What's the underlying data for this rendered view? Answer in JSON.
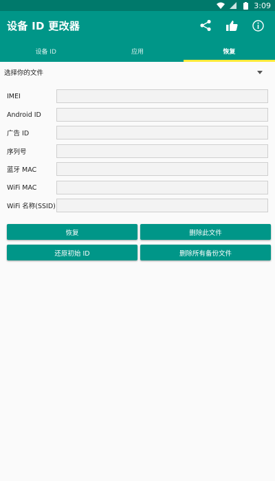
{
  "status_bar": {
    "time": "3:09"
  },
  "app_bar": {
    "title": "设备 ID 更改器"
  },
  "tabs": [
    {
      "label": "设备 ID"
    },
    {
      "label": "应用"
    },
    {
      "label": "恢复"
    }
  ],
  "file_select": {
    "label": "选择你的文件"
  },
  "fields": [
    {
      "label": "IMEI",
      "value": ""
    },
    {
      "label": "Android ID",
      "value": ""
    },
    {
      "label": "广告 ID",
      "value": ""
    },
    {
      "label": "序列号",
      "value": ""
    },
    {
      "label": "蓝牙 MAC",
      "value": ""
    },
    {
      "label": "WiFi MAC",
      "value": ""
    },
    {
      "label": "WiFi 名称(SSID)",
      "value": ""
    }
  ],
  "buttons": {
    "restore": "恢复",
    "delete_file": "删除此文件",
    "restore_original": "还原初始 ID",
    "delete_all": "删除所有备份文件"
  },
  "colors": {
    "primary": "#009688",
    "status_bar": "#00796b",
    "tab_indicator": "#ffeb3b"
  },
  "icons": {
    "status": [
      "wifi-icon",
      "signal-icon",
      "battery-icon"
    ],
    "actions": [
      "share-icon",
      "thumbs-up-icon",
      "info-icon"
    ]
  }
}
